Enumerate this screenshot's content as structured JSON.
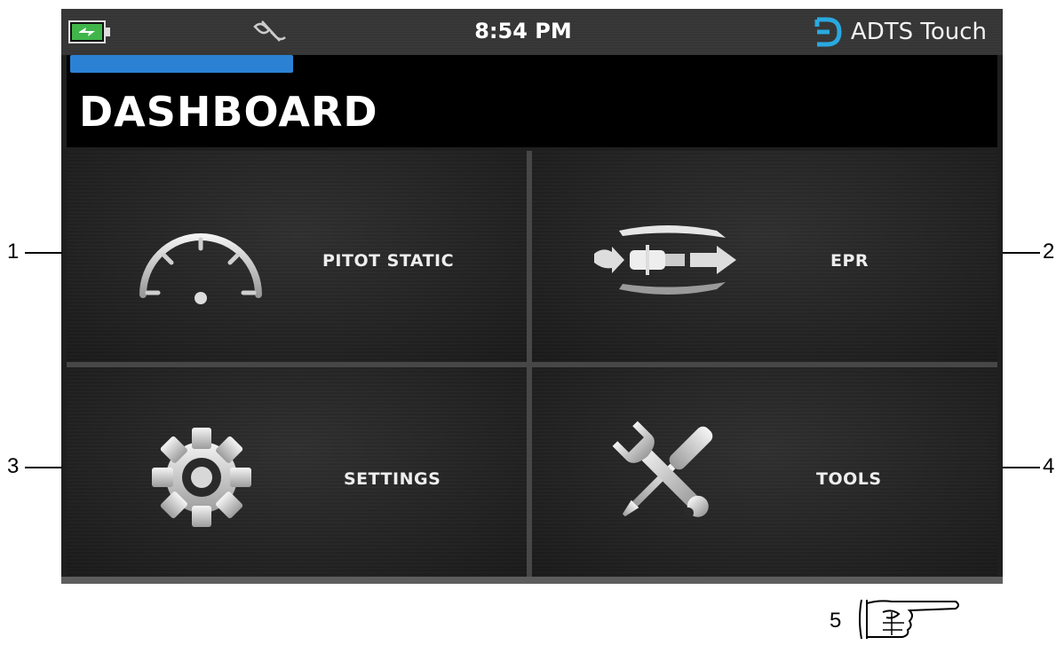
{
  "status_bar": {
    "time": "8:54 PM",
    "brand_name": "ADTS Touch",
    "battery_icon": "battery-charging-icon",
    "usb_icon": "usb-disconnected-icon",
    "brand_logo_icon": "druck-logo-icon",
    "brand_color": "#29a9e0",
    "battery_color": "#3fb54a"
  },
  "header": {
    "title": "DASHBOARD",
    "progress_fraction": 0.49,
    "progress_color": "#2b82d4"
  },
  "tiles": [
    {
      "label": "PITOT STATIC",
      "icon": "gauge-icon"
    },
    {
      "label": "EPR",
      "icon": "jet-engine-icon"
    },
    {
      "label": "SETTINGS",
      "icon": "gear-icon"
    },
    {
      "label": "TOOLS",
      "icon": "wrench-screwdriver-icon"
    }
  ],
  "callouts": [
    "1",
    "2",
    "3",
    "4",
    "5"
  ],
  "callout_icon": "pointing-hand-icon"
}
